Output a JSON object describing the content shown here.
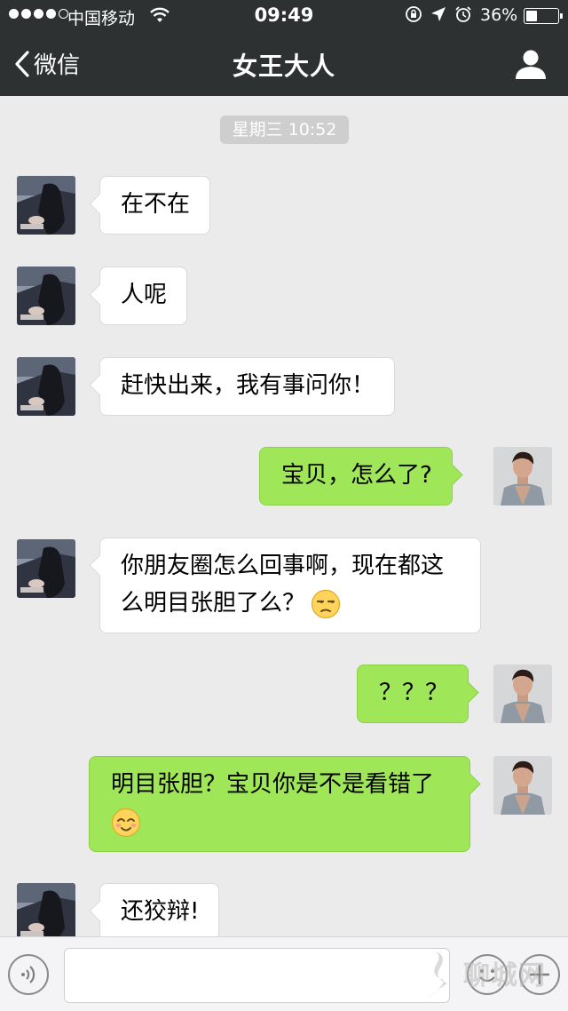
{
  "status_bar": {
    "carrier": "中国移动",
    "time": "09:49",
    "battery_text": "36%",
    "battery_level": 0.36,
    "signal_dots_filled": 4,
    "signal_dots_total": 5,
    "icons": [
      "wifi-icon",
      "rotation-lock-icon",
      "location-icon",
      "alarm-icon",
      "battery-icon"
    ]
  },
  "nav": {
    "back_label": "微信",
    "title": "女王大人",
    "right_icon": "person-icon"
  },
  "chat": {
    "timestamp": "星期三 10:52",
    "messages": [
      {
        "sender": "other",
        "text": "在不在"
      },
      {
        "sender": "other",
        "text": "人呢"
      },
      {
        "sender": "other",
        "text": "赶快出来，我有事问你！"
      },
      {
        "sender": "me",
        "text": "宝贝，怎么了?"
      },
      {
        "sender": "other",
        "text_line1": "你朋友圈怎么回事啊，现在都这",
        "text_line2": "么明目张胆了么？",
        "emoji": "unamused-face-emoji"
      },
      {
        "sender": "me",
        "text": "？？？"
      },
      {
        "sender": "me",
        "text": "明目张胆？宝贝你是不是看错了",
        "emoji": "smiling-face-emoji"
      },
      {
        "sender": "other",
        "text": "还狡辩!"
      }
    ]
  },
  "input_bar": {
    "left_icon": "voice-icon",
    "emoji_icon": "emoji-icon",
    "plus_icon": "plus-icon",
    "watermark": "聊城网"
  },
  "colors": {
    "nav_bg": "#2e3132",
    "chat_bg": "#ebebeb",
    "my_bubble": "#9fe658",
    "their_bubble": "#ffffff"
  }
}
